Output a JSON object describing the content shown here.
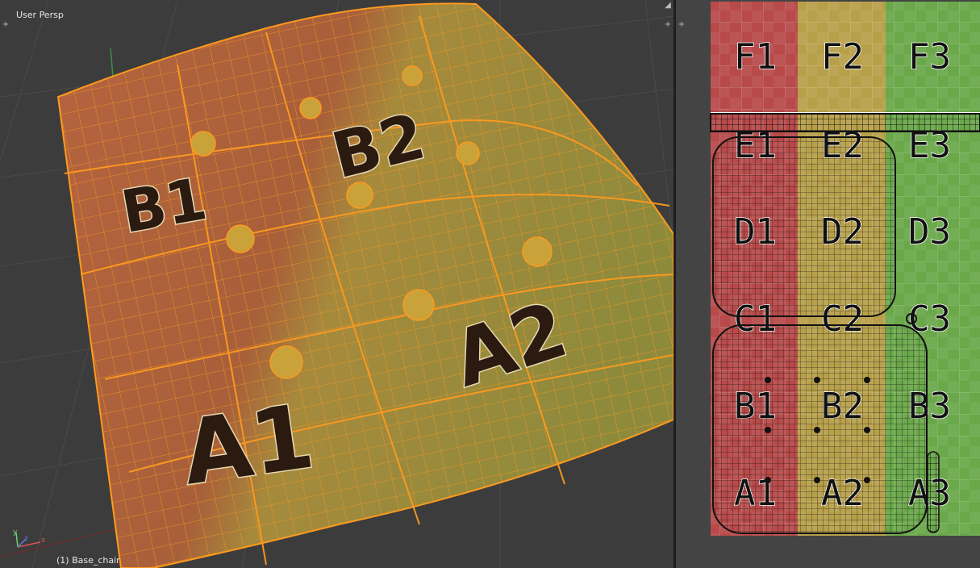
{
  "viewport3d": {
    "view_label": "User Persp",
    "object_label": "(1) Base_chair",
    "axes": {
      "x": "x",
      "y": "y",
      "z": "z"
    }
  },
  "texture_labels": {
    "a1": "A1",
    "a2": "A2",
    "b1": "B1",
    "b2": "B2",
    "f1": "F1",
    "f2": "F2",
    "f3": "F3",
    "e1": "E1",
    "e2": "E2",
    "e3": "E3",
    "d1": "D1",
    "d2": "D2",
    "d3": "D3",
    "c1": "C1",
    "c2": "C2",
    "c3": "C3",
    "b3": "B3",
    "a3": "A3"
  },
  "colors": {
    "wire": "#ff9a1e",
    "mesh_red": "#a85a3a",
    "mesh_yellow": "#9a8a3a",
    "uv_red": "#b84a4a",
    "uv_yellow": "#b8a04a",
    "uv_green": "#6aa84a"
  },
  "icons": [
    "corner-plus-icon",
    "axis-gizmo-icon"
  ]
}
